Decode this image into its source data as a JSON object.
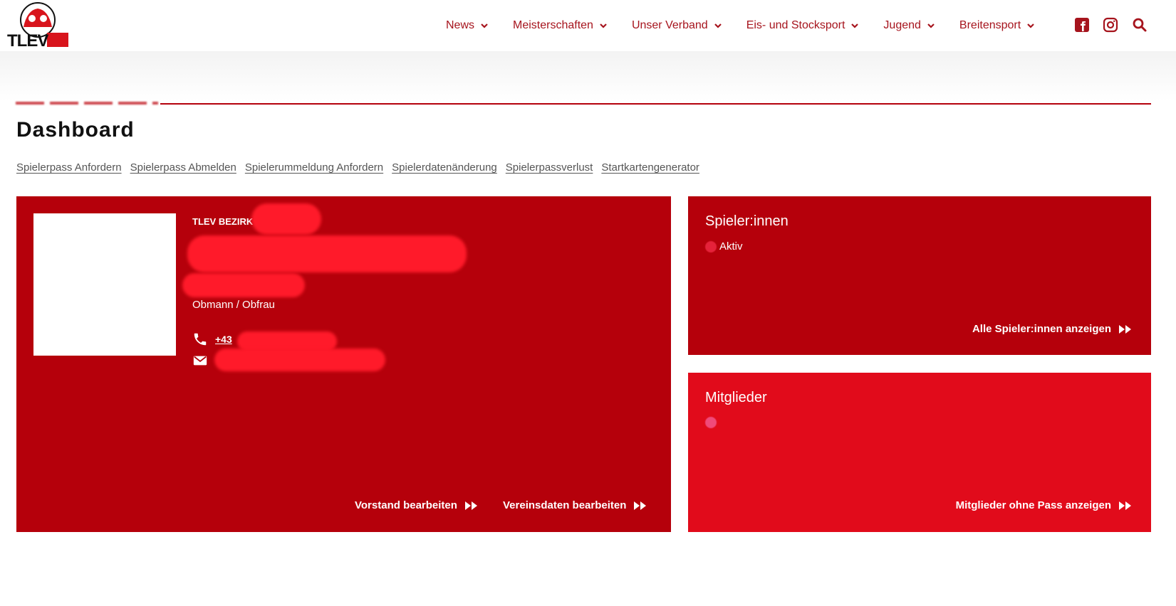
{
  "header": {
    "logo_text": "TLEV",
    "nav": [
      {
        "label": "News"
      },
      {
        "label": "Meisterschaften"
      },
      {
        "label": "Unser Verband"
      },
      {
        "label": "Eis- und Stocksport"
      },
      {
        "label": "Jugend"
      },
      {
        "label": "Breitensport"
      }
    ],
    "icons": [
      "facebook-icon",
      "instagram-icon",
      "search-icon"
    ]
  },
  "page": {
    "title": "Dashboard",
    "sublinks": [
      "Spielerpass Anfordern",
      "Spielerpass Abmelden",
      "Spielerummeldung Anfordern",
      "Spielerdatenänderung",
      "Spielerpassverlust",
      "Startkartengenerator"
    ]
  },
  "club_card": {
    "club_prefix": "TLEV BEZIRK",
    "role": "Obmann / Obfrau",
    "phone_prefix": "+43",
    "actions": {
      "board": "Vorstand bearbeiten",
      "club": "Vereinsdaten bearbeiten"
    }
  },
  "players_card": {
    "title": "Spieler:innen",
    "status": "Aktiv",
    "action": "Alle Spieler:innen anzeigen"
  },
  "members_card": {
    "title": "Mitglieder",
    "action": "Mitglieder ohne Pass anzeigen"
  },
  "colors": {
    "brand": "#b5000b",
    "accent": "#e10b1b",
    "nav_text": "#a6141d"
  }
}
